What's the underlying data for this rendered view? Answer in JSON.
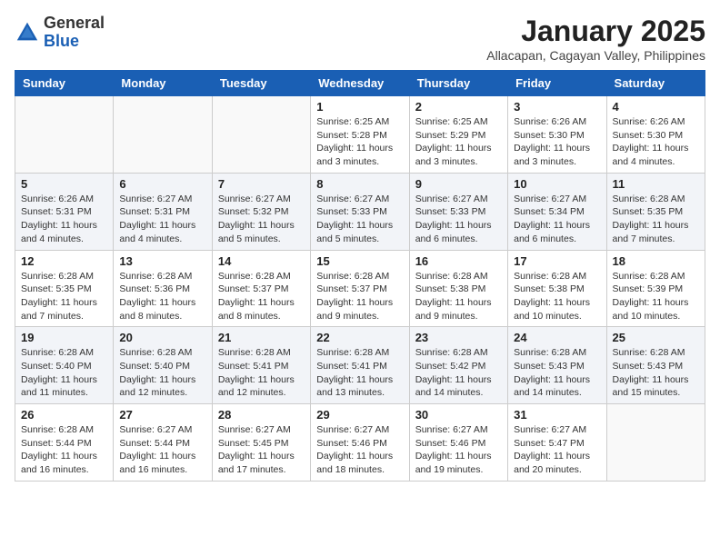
{
  "header": {
    "logo_general": "General",
    "logo_blue": "Blue",
    "month": "January 2025",
    "location": "Allacapan, Cagayan Valley, Philippines"
  },
  "weekdays": [
    "Sunday",
    "Monday",
    "Tuesday",
    "Wednesday",
    "Thursday",
    "Friday",
    "Saturday"
  ],
  "weeks": [
    [
      {
        "day": "",
        "info": ""
      },
      {
        "day": "",
        "info": ""
      },
      {
        "day": "",
        "info": ""
      },
      {
        "day": "1",
        "info": "Sunrise: 6:25 AM\nSunset: 5:28 PM\nDaylight: 11 hours\nand 3 minutes."
      },
      {
        "day": "2",
        "info": "Sunrise: 6:25 AM\nSunset: 5:29 PM\nDaylight: 11 hours\nand 3 minutes."
      },
      {
        "day": "3",
        "info": "Sunrise: 6:26 AM\nSunset: 5:30 PM\nDaylight: 11 hours\nand 3 minutes."
      },
      {
        "day": "4",
        "info": "Sunrise: 6:26 AM\nSunset: 5:30 PM\nDaylight: 11 hours\nand 4 minutes."
      }
    ],
    [
      {
        "day": "5",
        "info": "Sunrise: 6:26 AM\nSunset: 5:31 PM\nDaylight: 11 hours\nand 4 minutes."
      },
      {
        "day": "6",
        "info": "Sunrise: 6:27 AM\nSunset: 5:31 PM\nDaylight: 11 hours\nand 4 minutes."
      },
      {
        "day": "7",
        "info": "Sunrise: 6:27 AM\nSunset: 5:32 PM\nDaylight: 11 hours\nand 5 minutes."
      },
      {
        "day": "8",
        "info": "Sunrise: 6:27 AM\nSunset: 5:33 PM\nDaylight: 11 hours\nand 5 minutes."
      },
      {
        "day": "9",
        "info": "Sunrise: 6:27 AM\nSunset: 5:33 PM\nDaylight: 11 hours\nand 6 minutes."
      },
      {
        "day": "10",
        "info": "Sunrise: 6:27 AM\nSunset: 5:34 PM\nDaylight: 11 hours\nand 6 minutes."
      },
      {
        "day": "11",
        "info": "Sunrise: 6:28 AM\nSunset: 5:35 PM\nDaylight: 11 hours\nand 7 minutes."
      }
    ],
    [
      {
        "day": "12",
        "info": "Sunrise: 6:28 AM\nSunset: 5:35 PM\nDaylight: 11 hours\nand 7 minutes."
      },
      {
        "day": "13",
        "info": "Sunrise: 6:28 AM\nSunset: 5:36 PM\nDaylight: 11 hours\nand 8 minutes."
      },
      {
        "day": "14",
        "info": "Sunrise: 6:28 AM\nSunset: 5:37 PM\nDaylight: 11 hours\nand 8 minutes."
      },
      {
        "day": "15",
        "info": "Sunrise: 6:28 AM\nSunset: 5:37 PM\nDaylight: 11 hours\nand 9 minutes."
      },
      {
        "day": "16",
        "info": "Sunrise: 6:28 AM\nSunset: 5:38 PM\nDaylight: 11 hours\nand 9 minutes."
      },
      {
        "day": "17",
        "info": "Sunrise: 6:28 AM\nSunset: 5:38 PM\nDaylight: 11 hours\nand 10 minutes."
      },
      {
        "day": "18",
        "info": "Sunrise: 6:28 AM\nSunset: 5:39 PM\nDaylight: 11 hours\nand 10 minutes."
      }
    ],
    [
      {
        "day": "19",
        "info": "Sunrise: 6:28 AM\nSunset: 5:40 PM\nDaylight: 11 hours\nand 11 minutes."
      },
      {
        "day": "20",
        "info": "Sunrise: 6:28 AM\nSunset: 5:40 PM\nDaylight: 11 hours\nand 12 minutes."
      },
      {
        "day": "21",
        "info": "Sunrise: 6:28 AM\nSunset: 5:41 PM\nDaylight: 11 hours\nand 12 minutes."
      },
      {
        "day": "22",
        "info": "Sunrise: 6:28 AM\nSunset: 5:41 PM\nDaylight: 11 hours\nand 13 minutes."
      },
      {
        "day": "23",
        "info": "Sunrise: 6:28 AM\nSunset: 5:42 PM\nDaylight: 11 hours\nand 14 minutes."
      },
      {
        "day": "24",
        "info": "Sunrise: 6:28 AM\nSunset: 5:43 PM\nDaylight: 11 hours\nand 14 minutes."
      },
      {
        "day": "25",
        "info": "Sunrise: 6:28 AM\nSunset: 5:43 PM\nDaylight: 11 hours\nand 15 minutes."
      }
    ],
    [
      {
        "day": "26",
        "info": "Sunrise: 6:28 AM\nSunset: 5:44 PM\nDaylight: 11 hours\nand 16 minutes."
      },
      {
        "day": "27",
        "info": "Sunrise: 6:27 AM\nSunset: 5:44 PM\nDaylight: 11 hours\nand 16 minutes."
      },
      {
        "day": "28",
        "info": "Sunrise: 6:27 AM\nSunset: 5:45 PM\nDaylight: 11 hours\nand 17 minutes."
      },
      {
        "day": "29",
        "info": "Sunrise: 6:27 AM\nSunset: 5:46 PM\nDaylight: 11 hours\nand 18 minutes."
      },
      {
        "day": "30",
        "info": "Sunrise: 6:27 AM\nSunset: 5:46 PM\nDaylight: 11 hours\nand 19 minutes."
      },
      {
        "day": "31",
        "info": "Sunrise: 6:27 AM\nSunset: 5:47 PM\nDaylight: 11 hours\nand 20 minutes."
      },
      {
        "day": "",
        "info": ""
      }
    ]
  ]
}
